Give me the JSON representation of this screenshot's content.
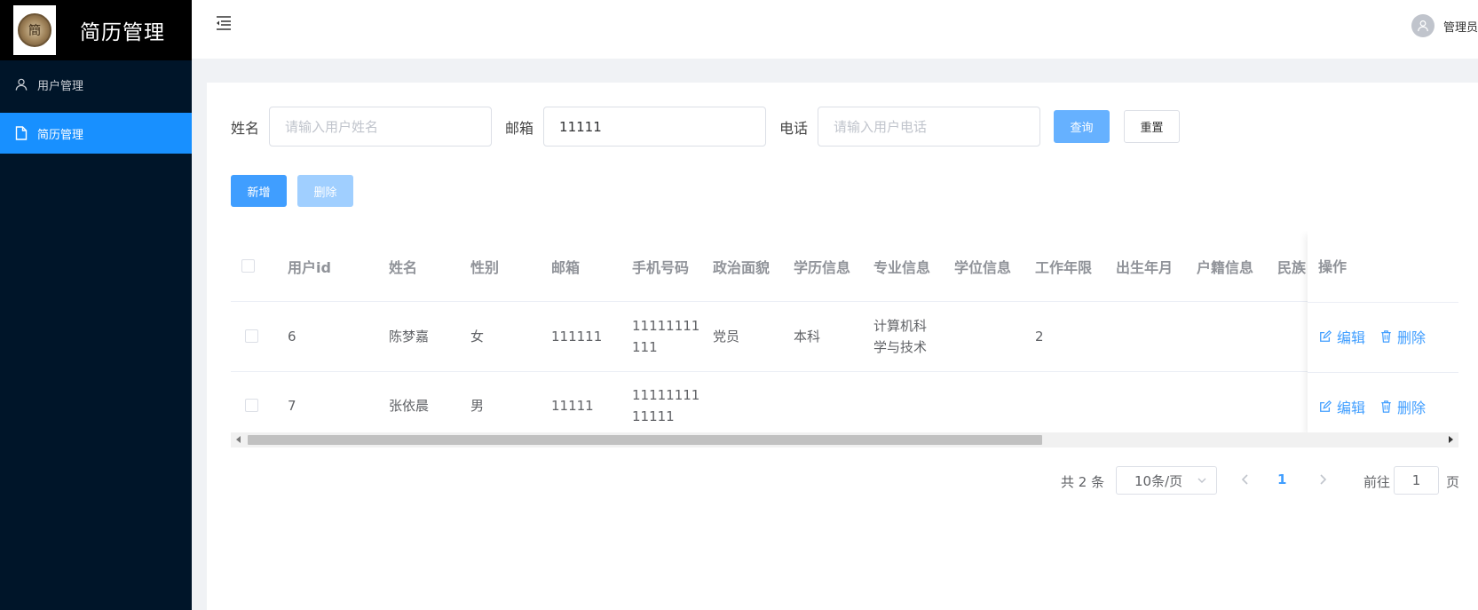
{
  "sidebar": {
    "logo_text": "簡",
    "title": "简历管理",
    "items": [
      {
        "label": "用户管理",
        "icon": "user-icon"
      },
      {
        "label": "简历管理",
        "icon": "document-icon",
        "active": true
      }
    ]
  },
  "header": {
    "user_name": "管理员"
  },
  "filters": {
    "name_label": "姓名",
    "name_placeholder": "请输入用户姓名",
    "name_value": "",
    "email_label": "邮箱",
    "email_value": "11111",
    "phone_label": "电话",
    "phone_placeholder": "请输入用户电话",
    "phone_value": "",
    "query_label": "查询",
    "reset_label": "重置"
  },
  "actions": {
    "add_label": "新增",
    "delete_label": "删除"
  },
  "table": {
    "columns": [
      "用户id",
      "姓名",
      "性别",
      "邮箱",
      "手机号码",
      "政治面貌",
      "学历信息",
      "专业信息",
      "学位信息",
      "工作年限",
      "出生年月",
      "户籍信息",
      "民族",
      "操作"
    ],
    "rows": [
      {
        "id": "6",
        "name": "陈梦嘉",
        "gender": "女",
        "email": "111111",
        "phone_l1": "11111111",
        "phone_l2": "111",
        "politics": "党员",
        "education": "本科",
        "major_l1": "计算机科",
        "major_l2": "学与技术",
        "degree": "",
        "years": "2"
      },
      {
        "id": "7",
        "name": "张依晨",
        "gender": "男",
        "email": "11111",
        "phone_l1": "11111111",
        "phone_l2": "11111",
        "politics": "",
        "education": "",
        "major_l1": "",
        "major_l2": "",
        "degree": "",
        "years": ""
      }
    ],
    "edit_label": "编辑",
    "delete_label": "删除"
  },
  "pagination": {
    "total": "共 2 条",
    "page_size": "10条/页",
    "current_page": "1",
    "goto_label": "前往",
    "goto_value": "1",
    "page_suffix": "页"
  },
  "colors": {
    "primary": "#409eff",
    "sidebar_bg": "#001529",
    "active_menu": "#1890ff"
  }
}
